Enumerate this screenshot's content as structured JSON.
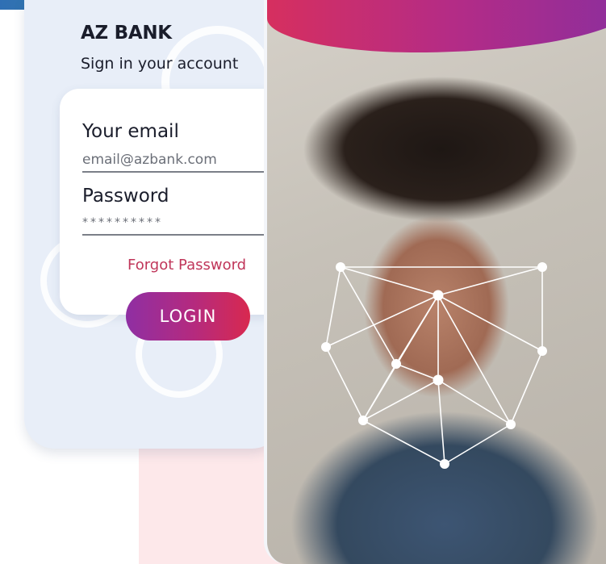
{
  "brand": {
    "name": "AZ BANK",
    "subtitle": "Sign in your account"
  },
  "form": {
    "email_label": "Your email",
    "email_value": "email@azbank.com",
    "password_label": "Password",
    "password_value": "**********",
    "forgot_label": "Forgot Password",
    "login_label": "LOGIN"
  },
  "colors": {
    "accent_start": "#8f2fa3",
    "accent_end": "#d8294f",
    "card_bg": "#e8eef8",
    "link": "#c0365a"
  },
  "icons": {
    "face_scan": "face-landmark-mesh-icon"
  }
}
